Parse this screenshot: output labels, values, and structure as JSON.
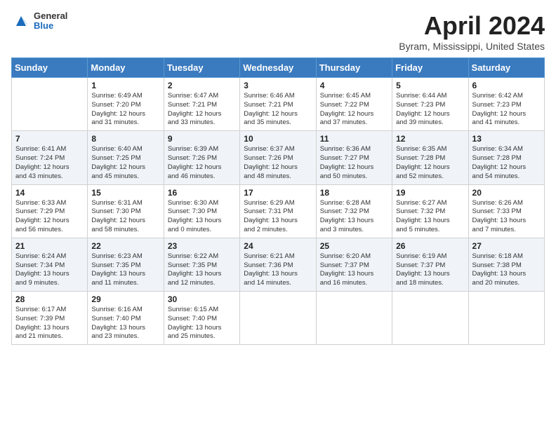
{
  "header": {
    "logo": {
      "general": "General",
      "blue": "Blue"
    },
    "title": "April 2024",
    "location": "Byram, Mississippi, United States"
  },
  "days_of_week": [
    "Sunday",
    "Monday",
    "Tuesday",
    "Wednesday",
    "Thursday",
    "Friday",
    "Saturday"
  ],
  "weeks": [
    [
      {
        "day": "",
        "info": ""
      },
      {
        "day": "1",
        "info": "Sunrise: 6:49 AM\nSunset: 7:20 PM\nDaylight: 12 hours\nand 31 minutes."
      },
      {
        "day": "2",
        "info": "Sunrise: 6:47 AM\nSunset: 7:21 PM\nDaylight: 12 hours\nand 33 minutes."
      },
      {
        "day": "3",
        "info": "Sunrise: 6:46 AM\nSunset: 7:21 PM\nDaylight: 12 hours\nand 35 minutes."
      },
      {
        "day": "4",
        "info": "Sunrise: 6:45 AM\nSunset: 7:22 PM\nDaylight: 12 hours\nand 37 minutes."
      },
      {
        "day": "5",
        "info": "Sunrise: 6:44 AM\nSunset: 7:23 PM\nDaylight: 12 hours\nand 39 minutes."
      },
      {
        "day": "6",
        "info": "Sunrise: 6:42 AM\nSunset: 7:23 PM\nDaylight: 12 hours\nand 41 minutes."
      }
    ],
    [
      {
        "day": "7",
        "info": "Sunrise: 6:41 AM\nSunset: 7:24 PM\nDaylight: 12 hours\nand 43 minutes."
      },
      {
        "day": "8",
        "info": "Sunrise: 6:40 AM\nSunset: 7:25 PM\nDaylight: 12 hours\nand 45 minutes."
      },
      {
        "day": "9",
        "info": "Sunrise: 6:39 AM\nSunset: 7:26 PM\nDaylight: 12 hours\nand 46 minutes."
      },
      {
        "day": "10",
        "info": "Sunrise: 6:37 AM\nSunset: 7:26 PM\nDaylight: 12 hours\nand 48 minutes."
      },
      {
        "day": "11",
        "info": "Sunrise: 6:36 AM\nSunset: 7:27 PM\nDaylight: 12 hours\nand 50 minutes."
      },
      {
        "day": "12",
        "info": "Sunrise: 6:35 AM\nSunset: 7:28 PM\nDaylight: 12 hours\nand 52 minutes."
      },
      {
        "day": "13",
        "info": "Sunrise: 6:34 AM\nSunset: 7:28 PM\nDaylight: 12 hours\nand 54 minutes."
      }
    ],
    [
      {
        "day": "14",
        "info": "Sunrise: 6:33 AM\nSunset: 7:29 PM\nDaylight: 12 hours\nand 56 minutes."
      },
      {
        "day": "15",
        "info": "Sunrise: 6:31 AM\nSunset: 7:30 PM\nDaylight: 12 hours\nand 58 minutes."
      },
      {
        "day": "16",
        "info": "Sunrise: 6:30 AM\nSunset: 7:30 PM\nDaylight: 13 hours\nand 0 minutes."
      },
      {
        "day": "17",
        "info": "Sunrise: 6:29 AM\nSunset: 7:31 PM\nDaylight: 13 hours\nand 2 minutes."
      },
      {
        "day": "18",
        "info": "Sunrise: 6:28 AM\nSunset: 7:32 PM\nDaylight: 13 hours\nand 3 minutes."
      },
      {
        "day": "19",
        "info": "Sunrise: 6:27 AM\nSunset: 7:32 PM\nDaylight: 13 hours\nand 5 minutes."
      },
      {
        "day": "20",
        "info": "Sunrise: 6:26 AM\nSunset: 7:33 PM\nDaylight: 13 hours\nand 7 minutes."
      }
    ],
    [
      {
        "day": "21",
        "info": "Sunrise: 6:24 AM\nSunset: 7:34 PM\nDaylight: 13 hours\nand 9 minutes."
      },
      {
        "day": "22",
        "info": "Sunrise: 6:23 AM\nSunset: 7:35 PM\nDaylight: 13 hours\nand 11 minutes."
      },
      {
        "day": "23",
        "info": "Sunrise: 6:22 AM\nSunset: 7:35 PM\nDaylight: 13 hours\nand 12 minutes."
      },
      {
        "day": "24",
        "info": "Sunrise: 6:21 AM\nSunset: 7:36 PM\nDaylight: 13 hours\nand 14 minutes."
      },
      {
        "day": "25",
        "info": "Sunrise: 6:20 AM\nSunset: 7:37 PM\nDaylight: 13 hours\nand 16 minutes."
      },
      {
        "day": "26",
        "info": "Sunrise: 6:19 AM\nSunset: 7:37 PM\nDaylight: 13 hours\nand 18 minutes."
      },
      {
        "day": "27",
        "info": "Sunrise: 6:18 AM\nSunset: 7:38 PM\nDaylight: 13 hours\nand 20 minutes."
      }
    ],
    [
      {
        "day": "28",
        "info": "Sunrise: 6:17 AM\nSunset: 7:39 PM\nDaylight: 13 hours\nand 21 minutes."
      },
      {
        "day": "29",
        "info": "Sunrise: 6:16 AM\nSunset: 7:40 PM\nDaylight: 13 hours\nand 23 minutes."
      },
      {
        "day": "30",
        "info": "Sunrise: 6:15 AM\nSunset: 7:40 PM\nDaylight: 13 hours\nand 25 minutes."
      },
      {
        "day": "",
        "info": ""
      },
      {
        "day": "",
        "info": ""
      },
      {
        "day": "",
        "info": ""
      },
      {
        "day": "",
        "info": ""
      }
    ]
  ]
}
